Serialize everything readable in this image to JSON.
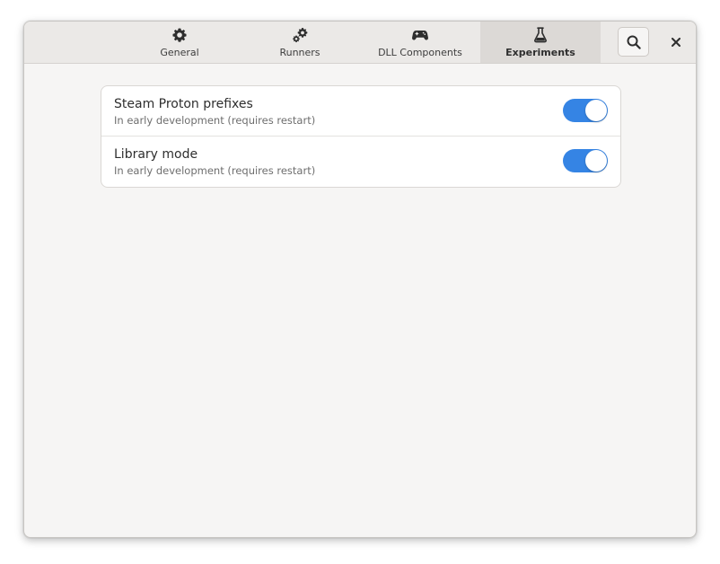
{
  "tabs": [
    {
      "label": "General",
      "icon": "gear-icon"
    },
    {
      "label": "Runners",
      "icon": "gears-icon"
    },
    {
      "label": "DLL Components",
      "icon": "gamepad-icon"
    },
    {
      "label": "Experiments",
      "icon": "flask-icon",
      "active": true
    }
  ],
  "header": {
    "search_icon": "search-icon",
    "close_icon": "close-icon"
  },
  "settings": [
    {
      "title": "Steam Proton prefixes",
      "subtitle": "In early development (requires restart)",
      "enabled": true
    },
    {
      "title": "Library mode",
      "subtitle": "In early development (requires restart)",
      "enabled": true
    }
  ],
  "colors": {
    "accent": "#3584e4",
    "window_bg": "#f6f5f4",
    "headerbar_bg": "#ebe9e7",
    "active_tab_bg": "#dcd9d6"
  }
}
